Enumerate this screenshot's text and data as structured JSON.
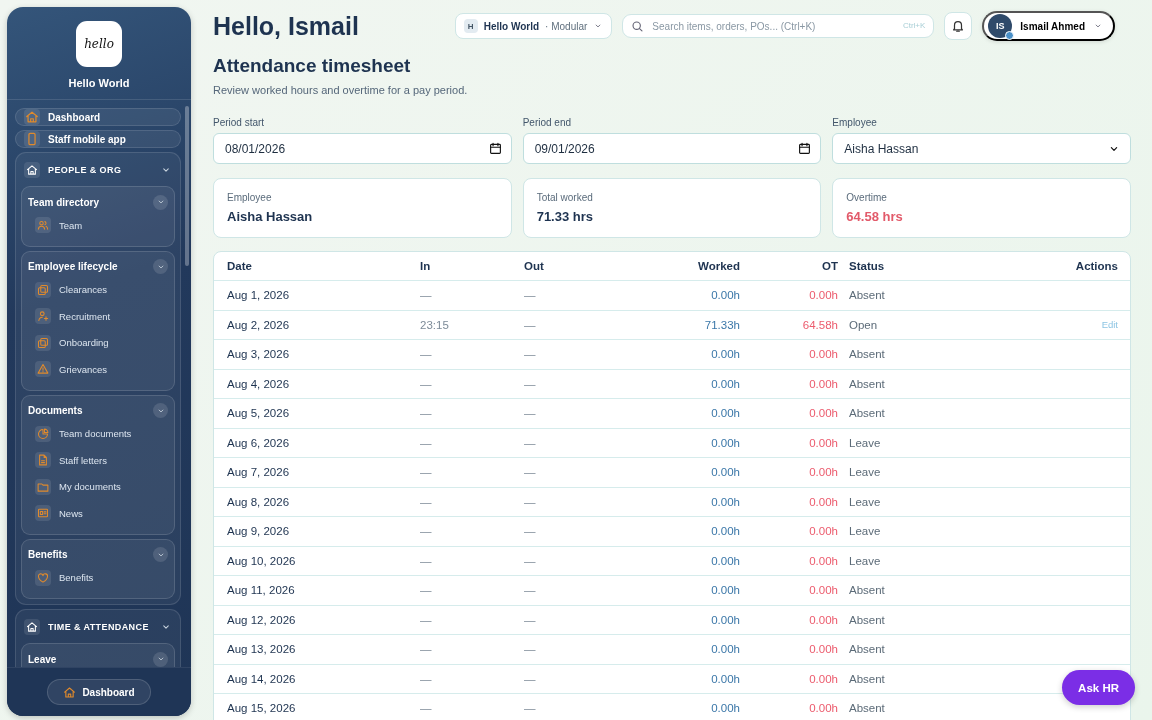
{
  "sidebar": {
    "logo_text": "hello",
    "brand": "Hello World",
    "top_items": [
      {
        "label": "Dashboard"
      },
      {
        "label": "Staff mobile app"
      }
    ],
    "sections": [
      {
        "title": "PEOPLE & ORG",
        "expanded": true,
        "groups": [
          {
            "title": "Team directory",
            "items": [
              "Team"
            ]
          },
          {
            "title": "Employee lifecycle",
            "items": [
              "Clearances",
              "Recruitment",
              "Onboarding",
              "Grievances"
            ]
          },
          {
            "title": "Documents",
            "items": [
              "Team documents",
              "Staff letters",
              "My documents",
              "News"
            ]
          },
          {
            "title": "Benefits",
            "items": [
              "Benefits"
            ]
          }
        ]
      },
      {
        "title": "TIME & ATTENDANCE",
        "expanded": true,
        "groups": [
          {
            "title": "Leave"
          }
        ]
      }
    ],
    "footer_button": "Dashboard"
  },
  "header": {
    "greeting": "Hello, Ismail",
    "workspace_badge": "H",
    "workspace": "Hello World",
    "workspace_suffix": "· Modular",
    "search_placeholder": "Search items, orders, POs... (Ctrl+K)",
    "search_shortcut": "Ctrl+K",
    "user_initials": "IS",
    "user_name": "Ismail Ahmed"
  },
  "page": {
    "title": "Attendance timesheet",
    "subtitle": "Review worked hours and overtime for a pay period."
  },
  "filters": [
    {
      "label": "Period start",
      "value": "08/01/2026",
      "kind": "date"
    },
    {
      "label": "Period end",
      "value": "09/01/2026",
      "kind": "date"
    },
    {
      "label": "Employee",
      "value": "Aisha Hassan",
      "kind": "select"
    }
  ],
  "summary": [
    {
      "label": "Employee",
      "value": "Aisha Hassan",
      "kind": "plain"
    },
    {
      "label": "Total worked",
      "value": "71.33 hrs",
      "kind": "plain"
    },
    {
      "label": "Overtime",
      "value": "64.58 hrs",
      "kind": "alert"
    }
  ],
  "table": {
    "columns": [
      "Date",
      "In",
      "Out",
      "Worked",
      "OT",
      "Status",
      "Actions"
    ],
    "rows": [
      {
        "date": "Aug 1, 2026",
        "in": "—",
        "out": "—",
        "worked": "0.00h",
        "ot": "0.00h",
        "status": "Absent"
      },
      {
        "date": "Aug 2, 2026",
        "in": "23:15",
        "out": "—",
        "worked": "71.33h",
        "ot": "64.58h",
        "status": "Open",
        "action": "Edit"
      },
      {
        "date": "Aug 3, 2026",
        "in": "—",
        "out": "—",
        "worked": "0.00h",
        "ot": "0.00h",
        "status": "Absent"
      },
      {
        "date": "Aug 4, 2026",
        "in": "—",
        "out": "—",
        "worked": "0.00h",
        "ot": "0.00h",
        "status": "Absent"
      },
      {
        "date": "Aug 5, 2026",
        "in": "—",
        "out": "—",
        "worked": "0.00h",
        "ot": "0.00h",
        "status": "Absent"
      },
      {
        "date": "Aug 6, 2026",
        "in": "—",
        "out": "—",
        "worked": "0.00h",
        "ot": "0.00h",
        "status": "Leave"
      },
      {
        "date": "Aug 7, 2026",
        "in": "—",
        "out": "—",
        "worked": "0.00h",
        "ot": "0.00h",
        "status": "Leave"
      },
      {
        "date": "Aug 8, 2026",
        "in": "—",
        "out": "—",
        "worked": "0.00h",
        "ot": "0.00h",
        "status": "Leave"
      },
      {
        "date": "Aug 9, 2026",
        "in": "—",
        "out": "—",
        "worked": "0.00h",
        "ot": "0.00h",
        "status": "Leave"
      },
      {
        "date": "Aug 10, 2026",
        "in": "—",
        "out": "—",
        "worked": "0.00h",
        "ot": "0.00h",
        "status": "Leave"
      },
      {
        "date": "Aug 11, 2026",
        "in": "—",
        "out": "—",
        "worked": "0.00h",
        "ot": "0.00h",
        "status": "Absent"
      },
      {
        "date": "Aug 12, 2026",
        "in": "—",
        "out": "—",
        "worked": "0.00h",
        "ot": "0.00h",
        "status": "Absent"
      },
      {
        "date": "Aug 13, 2026",
        "in": "—",
        "out": "—",
        "worked": "0.00h",
        "ot": "0.00h",
        "status": "Absent"
      },
      {
        "date": "Aug 14, 2026",
        "in": "—",
        "out": "—",
        "worked": "0.00h",
        "ot": "0.00h",
        "status": "Absent"
      },
      {
        "date": "Aug 15, 2026",
        "in": "—",
        "out": "—",
        "worked": "0.00h",
        "ot": "0.00h",
        "status": "Absent"
      }
    ]
  },
  "ask_button": "Ask HR"
}
